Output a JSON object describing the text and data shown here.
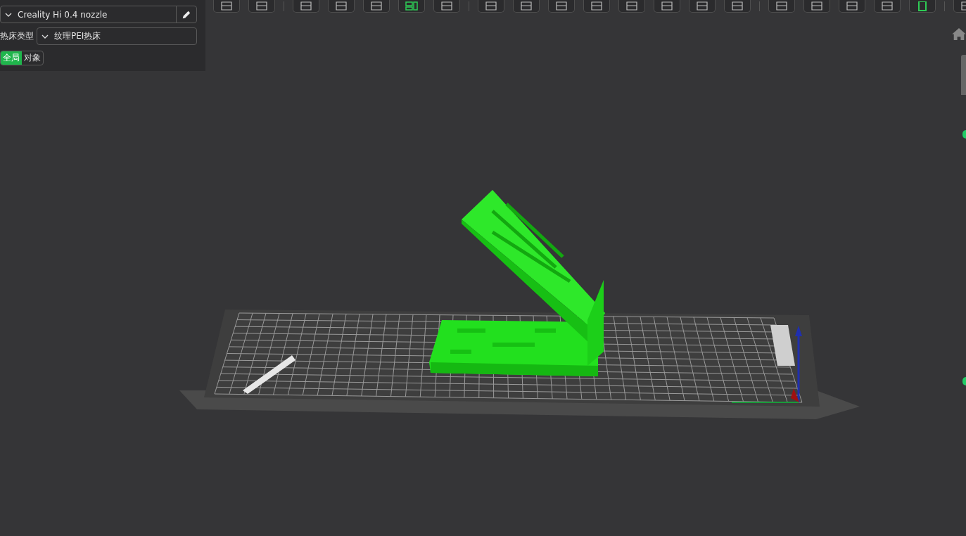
{
  "printer": {
    "value": "Creality Hi 0.4 nozzle"
  },
  "bed_type": {
    "label": "热床类型",
    "value": "纹理PEI热床"
  },
  "scope_tabs": [
    {
      "label": "全局",
      "selected": true
    },
    {
      "label": "对象",
      "selected": false
    }
  ]
}
